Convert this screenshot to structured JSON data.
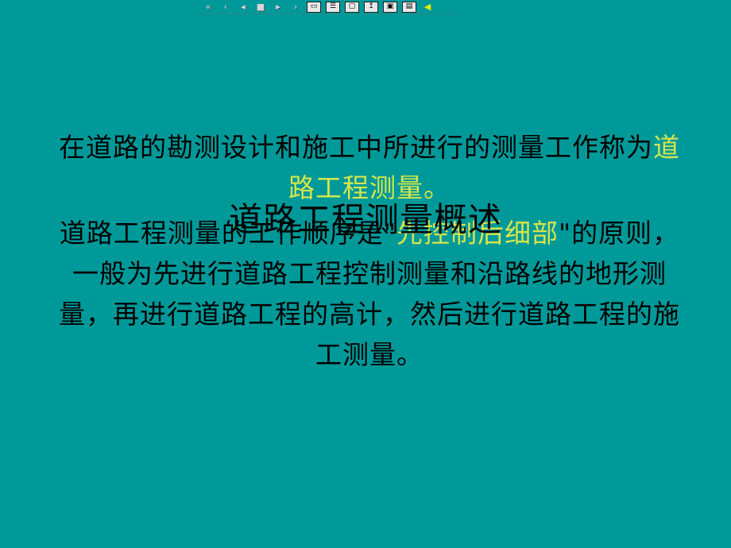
{
  "toolbar": {
    "buttons": [
      {
        "name": "first-slide-icon",
        "glyph": "«"
      },
      {
        "name": "prev-section-icon",
        "glyph": "‹"
      },
      {
        "name": "prev-slide-icon",
        "glyph": "◂"
      },
      {
        "name": "home-icon",
        "glyph": "■"
      },
      {
        "name": "next-slide-icon",
        "glyph": "▸"
      },
      {
        "name": "next-section-icon",
        "glyph": "›"
      },
      {
        "name": "thumbnail-icon",
        "glyph": "▭"
      },
      {
        "name": "outline-icon",
        "glyph": "☰"
      },
      {
        "name": "window-icon",
        "glyph": "▢"
      },
      {
        "name": "return-icon",
        "glyph": "↥"
      },
      {
        "name": "monitor-icon",
        "glyph": "▣"
      },
      {
        "name": "print-icon",
        "glyph": "▤"
      },
      {
        "name": "sound-icon",
        "glyph": "◀"
      }
    ]
  },
  "slide": {
    "title": "道路工程测量概述",
    "p1_a": "在道路的勘测设计和施工中所进行的测量工作称为",
    "p1_hl": "道路工程测量。",
    "p2_a": "道路工程测量的工作顺序是\"",
    "p2_hl": "先控制后细部",
    "p2_b": "\"的原则，一般为先进行道路工程控制测量和沿路线的地形测量，再进行道路工程的高计，然后进行道路工程的施工测量。"
  },
  "colors": {
    "background": "#009999",
    "highlight": "#d6e64a",
    "text": "#000000"
  }
}
